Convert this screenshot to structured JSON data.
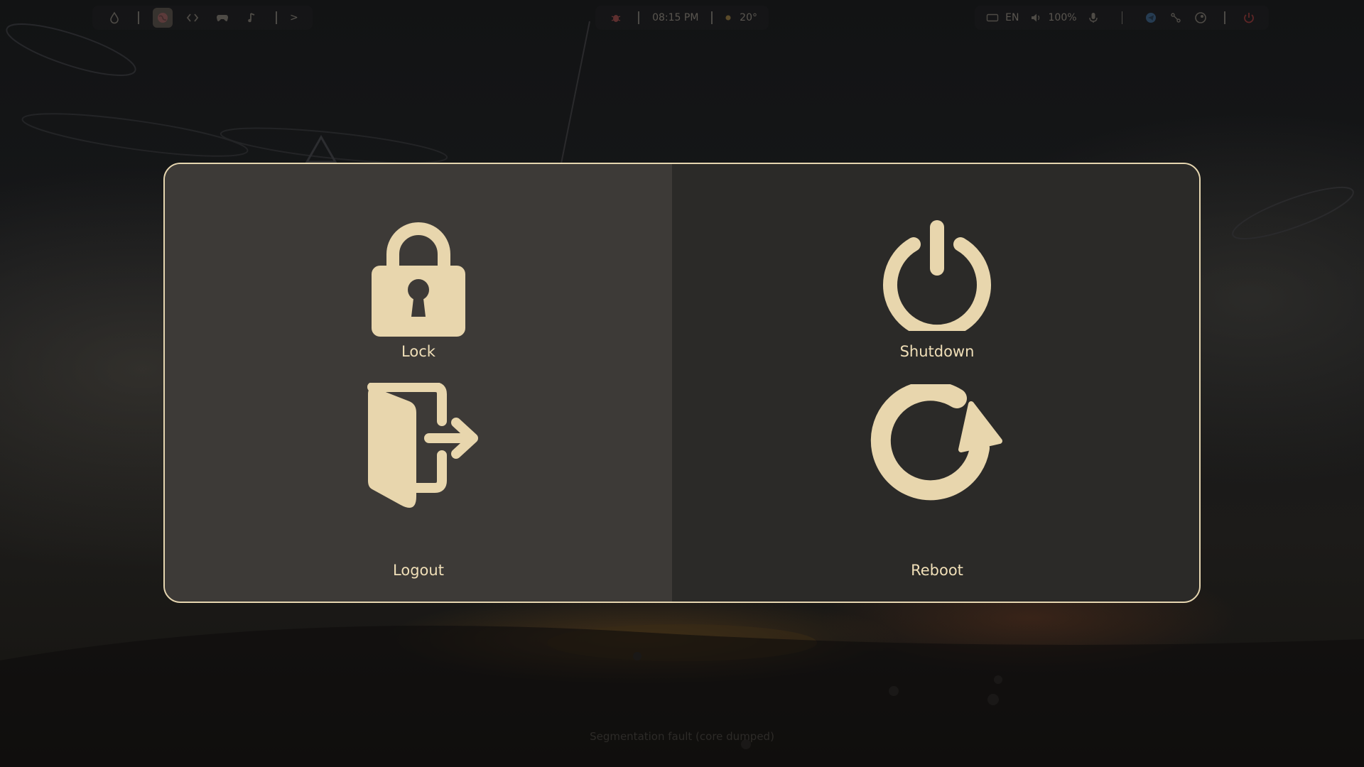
{
  "colors": {
    "accent": "#e8d6ad",
    "label": "#f0dfb8",
    "panel_left": "#3d3a37",
    "panel_right": "#2b2a28",
    "border": "#e6d6b0"
  },
  "topbar": {
    "left_icons": [
      "droplet-icon",
      "globe-icon",
      "code-icon",
      "gamepad-icon",
      "music-icon"
    ],
    "more_label": ">",
    "clock": "08:15 PM",
    "weather": "20°",
    "keyboard_layout": "EN",
    "volume": "100%",
    "right_icons": [
      "bug-icon",
      "keyboard-icon",
      "volume-icon",
      "mic-icon",
      "telegram-icon",
      "network-icon",
      "steam-icon",
      "power-icon"
    ]
  },
  "power_menu": {
    "lock": {
      "label": "Lock",
      "icon": "lock-icon"
    },
    "shutdown": {
      "label": "Shutdown",
      "icon": "power-icon"
    },
    "logout": {
      "label": "Logout",
      "icon": "logout-door-icon"
    },
    "reboot": {
      "label": "Reboot",
      "icon": "reboot-icon"
    }
  },
  "bottom_text": "Segmentation fault (core dumped)"
}
